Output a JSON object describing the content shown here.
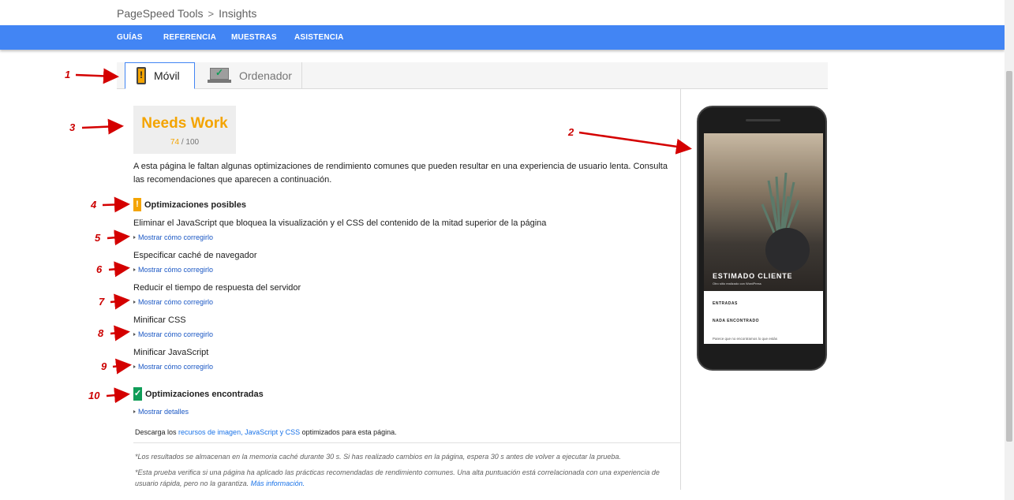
{
  "breadcrumb": {
    "root": "PageSpeed Tools",
    "separator": ">",
    "current": "Insights"
  },
  "nav": {
    "items": [
      "GUÍAS",
      "REFERENCIA",
      "MUESTRAS",
      "ASISTENCIA"
    ]
  },
  "tabs": {
    "mobile": "Móvil",
    "desktop": "Ordenador"
  },
  "score": {
    "verdict": "Needs Work",
    "value": "74",
    "max": "/ 100"
  },
  "description": "A esta página le faltan algunas optimizaciones de rendimiento comunes que pueden resultar en una experiencia de usuario lenta. Consulta las recomendaciones que aparecen a continuación.",
  "possible": {
    "title": "Optimizaciones posibles",
    "rules": [
      {
        "name": "Eliminar el JavaScript que bloquea la visualización y el CSS del contenido de la mitad superior de la página",
        "link": "Mostrar cómo corregirlo"
      },
      {
        "name": "Especificar caché de navegador",
        "link": "Mostrar cómo corregirlo"
      },
      {
        "name": "Reducir el tiempo de respuesta del servidor",
        "link": "Mostrar cómo corregirlo"
      },
      {
        "name": "Minificar CSS",
        "link": "Mostrar cómo corregirlo"
      },
      {
        "name": "Minificar JavaScript",
        "link": "Mostrar cómo corregirlo"
      }
    ]
  },
  "found": {
    "title": "Optimizaciones encontradas",
    "link": "Mostrar detalles"
  },
  "download": {
    "prefix": "Descarga los ",
    "link": "recursos de imagen, JavaScript y CSS",
    "suffix": " optimizados para esta página."
  },
  "notes": {
    "cache": "*Los resultados se almacenan en la memoria caché durante 30 s. Si has realizado cambios en la página, espera 30 s antes de volver a ejecutar la prueba.",
    "test": "*Esta prueba verifica si una página ha aplicado las prácticas recomendadas de rendimiento comunes. Una alta puntuación está correlacionada con una experiencia de usuario rápida, pero no la garantiza. ",
    "more": "Más información."
  },
  "preview": {
    "site_title": "ESTIMADO CLIENTE",
    "site_sub": "Otro sitio realizado con WordPress",
    "menu": "ENTRADAS",
    "heading": "NADA ENCONTRADO",
    "text": "Parece que no encontramos lo que estás"
  },
  "markers": [
    "1",
    "2",
    "3",
    "4",
    "5",
    "6",
    "7",
    "8",
    "9",
    "10"
  ]
}
